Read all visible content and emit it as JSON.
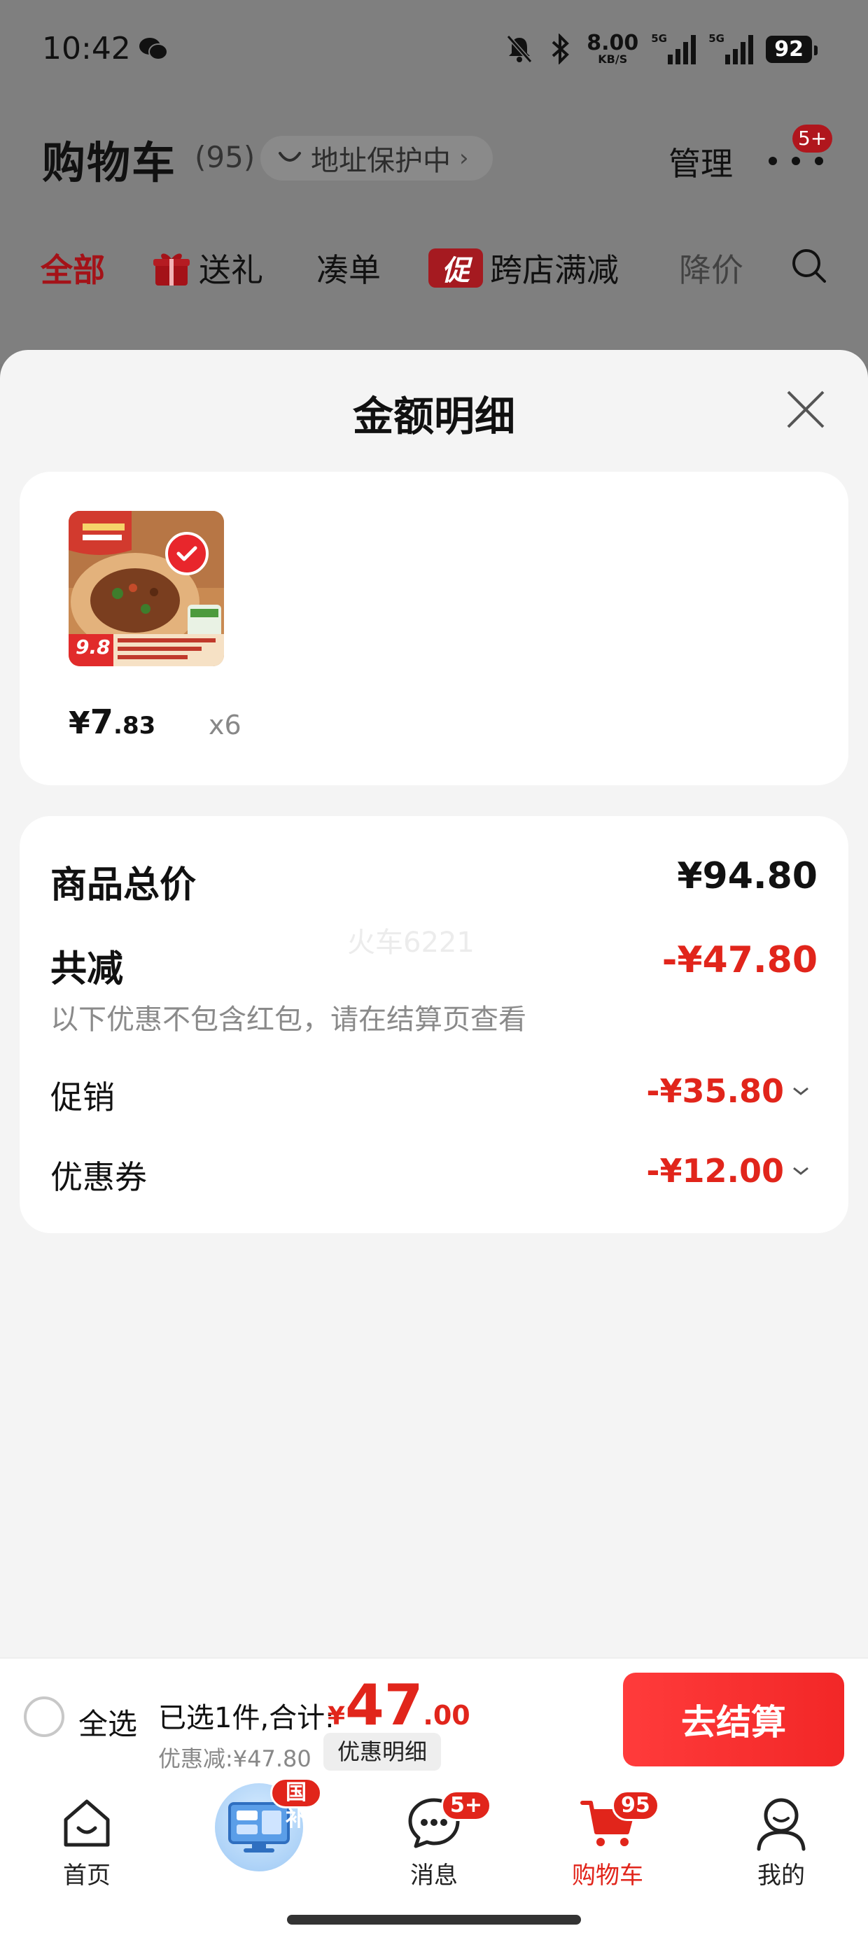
{
  "status_bar": {
    "time": "10:42",
    "net_speed": "8.00",
    "net_unit": "KB/S",
    "sim1": "5G",
    "sim2": "5G",
    "battery": "92"
  },
  "cart_header": {
    "title": "购物车",
    "count": "(95)",
    "address_label": "地址保护中",
    "address_arrow": "›",
    "manage_label": "管理",
    "more_badge": "5+"
  },
  "filter_tabs": [
    "全部",
    "送礼",
    "凑单",
    "跨店满减",
    "降价"
  ],
  "promo_icon_text": "促",
  "sheet": {
    "title": "金额明细",
    "item": {
      "price_symbol": "¥",
      "price_int": "7",
      "price_dec": ".83",
      "quantity": "x6",
      "image_price_tag": "9.8"
    },
    "summary": {
      "total_label": "商品总价",
      "total_value": "¥94.80",
      "reduce_label": "共减",
      "reduce_value": "-¥47.80",
      "note": "以下优惠不包含红包，请在结算页查看",
      "promo_label": "促销",
      "promo_value": "-¥35.80",
      "coupon_label": "优惠券",
      "coupon_value": "-¥12.00",
      "watermark": "火车6221"
    }
  },
  "checkout": {
    "select_all": "全选",
    "selected_text": "已选1件,合计:",
    "total_symbol": "¥",
    "total_int": "47",
    "total_dec": ".00",
    "discount_text": "优惠减:¥47.80",
    "detail_button": "优惠明细",
    "checkout_button": "去结算"
  },
  "bottom_nav": {
    "items": [
      {
        "label": "首页"
      },
      {
        "label": "",
        "badge": "国补"
      },
      {
        "label": "消息",
        "badge": "5+"
      },
      {
        "label": "购物车",
        "badge": "95"
      },
      {
        "label": "我的"
      }
    ]
  },
  "colors": {
    "accent": "#e1251b",
    "dim_background": "#7f7f7f",
    "sheet_background": "#f4f4f4"
  }
}
